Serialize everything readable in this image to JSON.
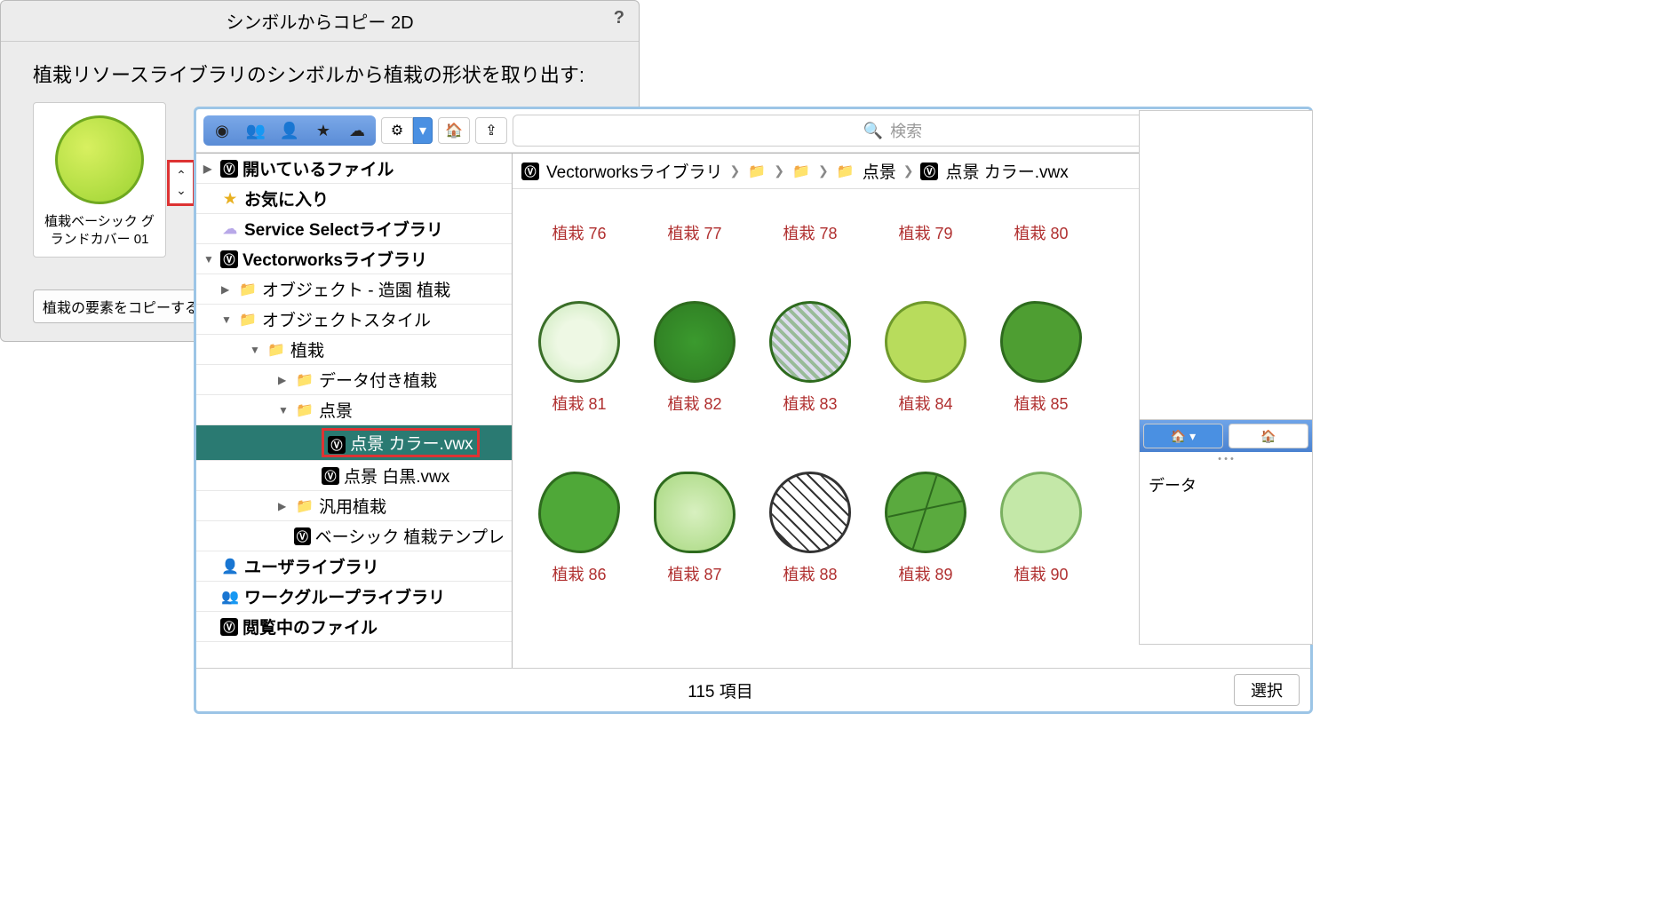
{
  "dialog": {
    "title": "シンボルからコピー 2D",
    "help": "?",
    "instruction": "植栽リソースライブラリのシンボルから植栽の形状を取り出す:",
    "preview_label": "植栽ベーシック グランドカバー 01",
    "copy_button": "植栽の要素をコピーする"
  },
  "search": {
    "placeholder": "検索"
  },
  "tree": {
    "open_files": "開いているファイル",
    "favorites": "お気に入り",
    "service_select": "Service Selectライブラリ",
    "vw_library": "Vectorworksライブラリ",
    "obj_landscape": "オブジェクト - 造園 植栽",
    "obj_style": "オブジェクトスタイル",
    "planting": "植栽",
    "data_planting": "データ付き植栽",
    "tenkei": "点景",
    "tenkei_color": "点景 カラー.vwx",
    "tenkei_bw": "点景 白黒.vwx",
    "generic_planting": "汎用植栽",
    "basic_template": "ベーシック 植栽テンプレ",
    "user_lib": "ユーザライブラリ",
    "workgroup_lib": "ワークグループライブラリ",
    "browsing_file": "閲覧中のファイル"
  },
  "breadcrumb": {
    "root": "Vectorworksライブラリ",
    "tenkei": "点景",
    "file": "点景 カラー.vwx"
  },
  "thumbs": {
    "r1": [
      "植栽 76",
      "植栽 77",
      "植栽 78",
      "植栽 79",
      "植栽 80"
    ],
    "r2": [
      "植栽 81",
      "植栽 82",
      "植栽 83",
      "植栽 84",
      "植栽 85"
    ],
    "r3": [
      "植栽 86",
      "植栽 87",
      "植栽 88",
      "植栽 89",
      "植栽 90"
    ]
  },
  "right_panel": {
    "data_label": "データ"
  },
  "footer": {
    "count": "115 項目",
    "select": "選択"
  }
}
